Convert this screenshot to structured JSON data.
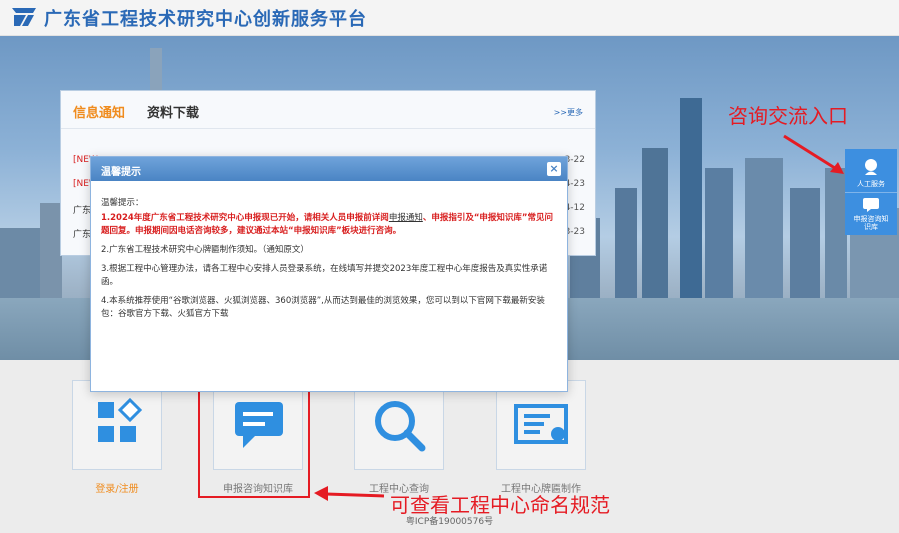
{
  "header": {
    "title": "广东省工程技术研究中心创新服务平台"
  },
  "news": {
    "tab_active": "信息通知",
    "tab_other": "资料下载",
    "more": ">>更多",
    "rows": [
      {
        "text": "[NEW",
        "date": "3-22",
        "color": "red"
      },
      {
        "text": "[NEW",
        "date": "4-23",
        "color": "red"
      },
      {
        "text": "广东",
        "date": "4-12",
        "color": "dark"
      },
      {
        "text": "广东",
        "date": "3-23",
        "color": "dark"
      }
    ]
  },
  "modal": {
    "title": "温馨提示",
    "close": "×",
    "greeting": "温馨提示：",
    "p1_a": "1.2024年度广东省工程技术研究中心申报现已开始，请相关人员申报前详阅",
    "p1_link": "申报通知",
    "p1_b": "、申报指引及“申报知识库”常见问题回复。申报期间因电话咨询较多，建议通过本站“申报知识库”板块进行咨询。",
    "p2": "2.广东省工程技术研究中心牌匾制作须知。（通知原文）",
    "p3": "3.根据工程中心管理办法，请各工程中心安排人员登录系统，在线填写并提交2023年度工程中心年度报告及真实性承诺函。",
    "p4": "4.本系统推荐使用“谷歌浏览器、火狐浏览器、360浏览器”,从而达到最佳的浏览效果，您可以到以下官网下载最新安装包：谷歌官方下载、火狐官方下载"
  },
  "sidebar": {
    "item1": "人工服务",
    "item2": "申报咨询知识库"
  },
  "annotations": {
    "consult_entry": "咨询交流入口",
    "view_naming": "可查看工程中心命名规范"
  },
  "tiles": [
    {
      "label": "登录/注册",
      "icon": "grid-diamond-icon"
    },
    {
      "label": "申报咨询知识库",
      "icon": "chat-bubble-icon"
    },
    {
      "label": "工程中心查询",
      "icon": "search-icon"
    },
    {
      "label": "工程中心牌匾制作",
      "icon": "certificate-icon"
    }
  ],
  "footer": {
    "icp": "粤ICP备19000576号"
  },
  "colors": {
    "brand": "#2a69b6",
    "accent": "#f08c1e",
    "annotation": "#e51b23",
    "icon_blue": "#2f8fe0"
  }
}
